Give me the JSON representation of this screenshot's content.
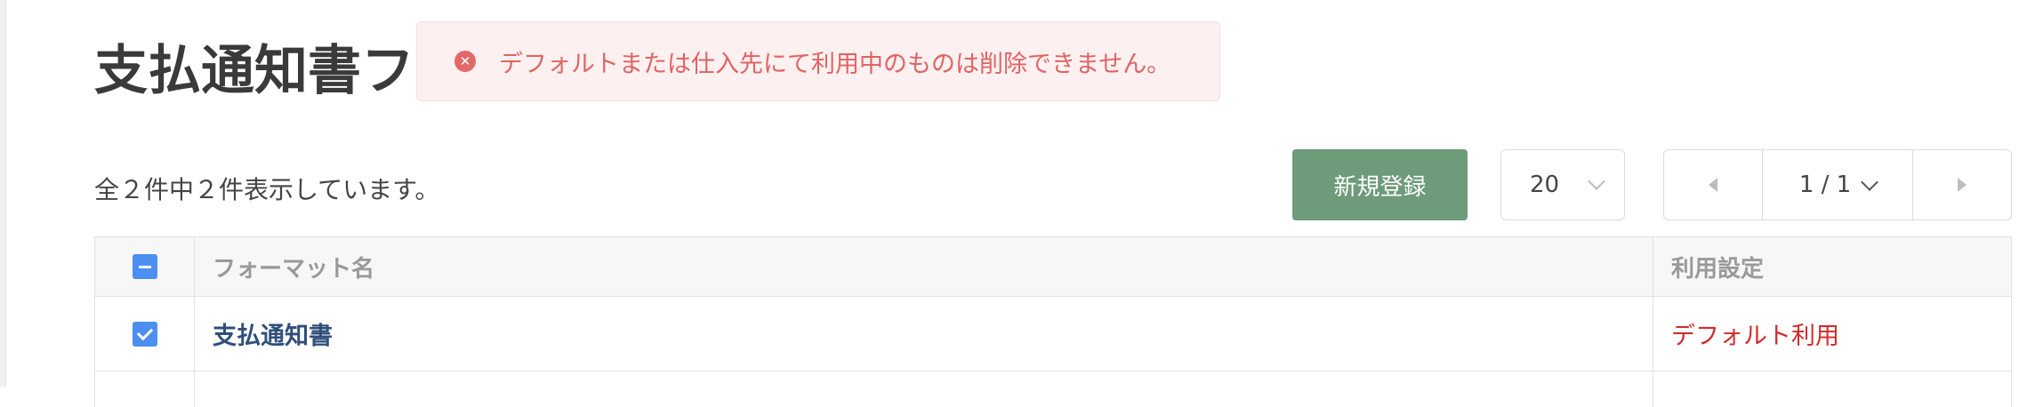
{
  "page": {
    "title": "支払通知書フ"
  },
  "toast": {
    "icon": "error-circle-icon",
    "message": "デフォルトまたは仕入先にて利用中のものは削除できません。"
  },
  "list": {
    "count_text": "全２件中２件表示しています。"
  },
  "toolbar": {
    "new_label": "新規登録",
    "per_page": "20",
    "page_indicator": "1 / 1"
  },
  "table": {
    "columns": [
      "フォーマット名",
      "利用設定"
    ],
    "rows": [
      {
        "name": "支払通知書",
        "usage": "デフォルト利用",
        "checked": true
      }
    ]
  },
  "colors": {
    "accent_green": "#6e9b7a",
    "checkbox_blue": "#4d8ff0",
    "error_red": "#e06464",
    "usage_red": "#d42a2a"
  }
}
